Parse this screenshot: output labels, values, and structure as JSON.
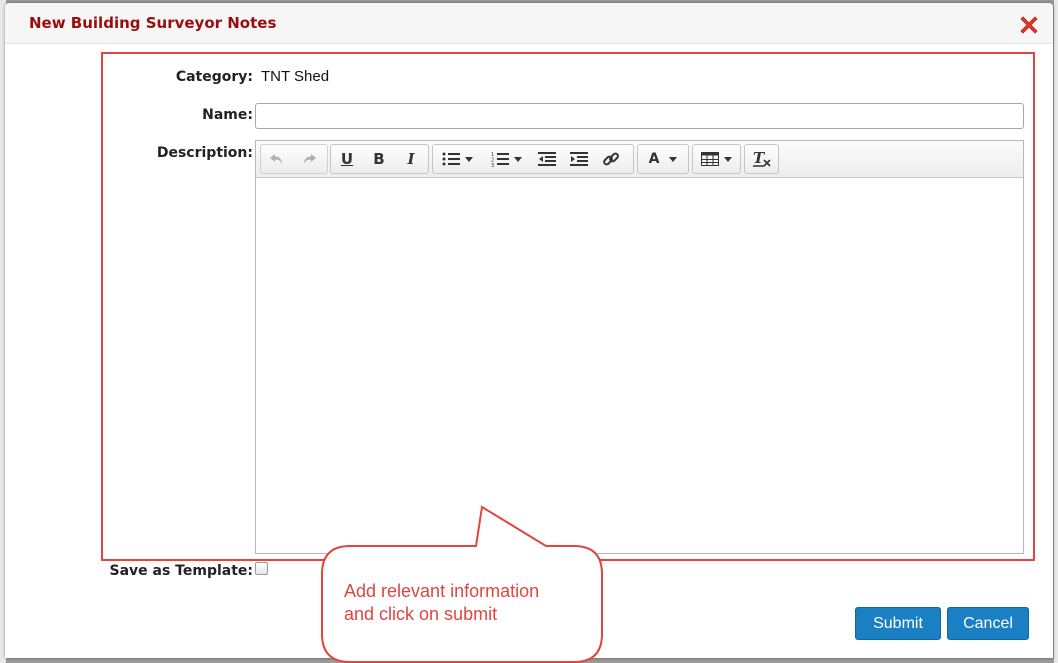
{
  "dialog": {
    "title": "New Building Surveyor Notes",
    "close_icon": "close-x-icon",
    "accent_color": "#9b0d0d"
  },
  "form": {
    "category_label": "Category:",
    "category_value": "TNT Shed",
    "name_label": "Name:",
    "name_value": "",
    "description_label": "Description:",
    "save_template_label": "Save as Template:",
    "save_template_checked": false
  },
  "editor": {
    "toolbar_icons": [
      "undo-icon",
      "redo-icon",
      "underline-icon",
      "bold-icon",
      "italic-icon",
      "bullet-list-icon",
      "numbered-list-icon",
      "outdent-icon",
      "indent-icon",
      "link-icon",
      "text-color-icon",
      "table-icon",
      "clear-format-icon"
    ],
    "bold_glyph": "B",
    "underline_glyph": "U",
    "italic_glyph": "I",
    "textcolor_glyph": "A"
  },
  "buttons": {
    "submit": "Submit",
    "cancel": "Cancel",
    "color": "#1a80c3"
  },
  "annotation": {
    "line1": "Add relevant information",
    "line2": "and click on submit",
    "color": "#e0463f"
  }
}
